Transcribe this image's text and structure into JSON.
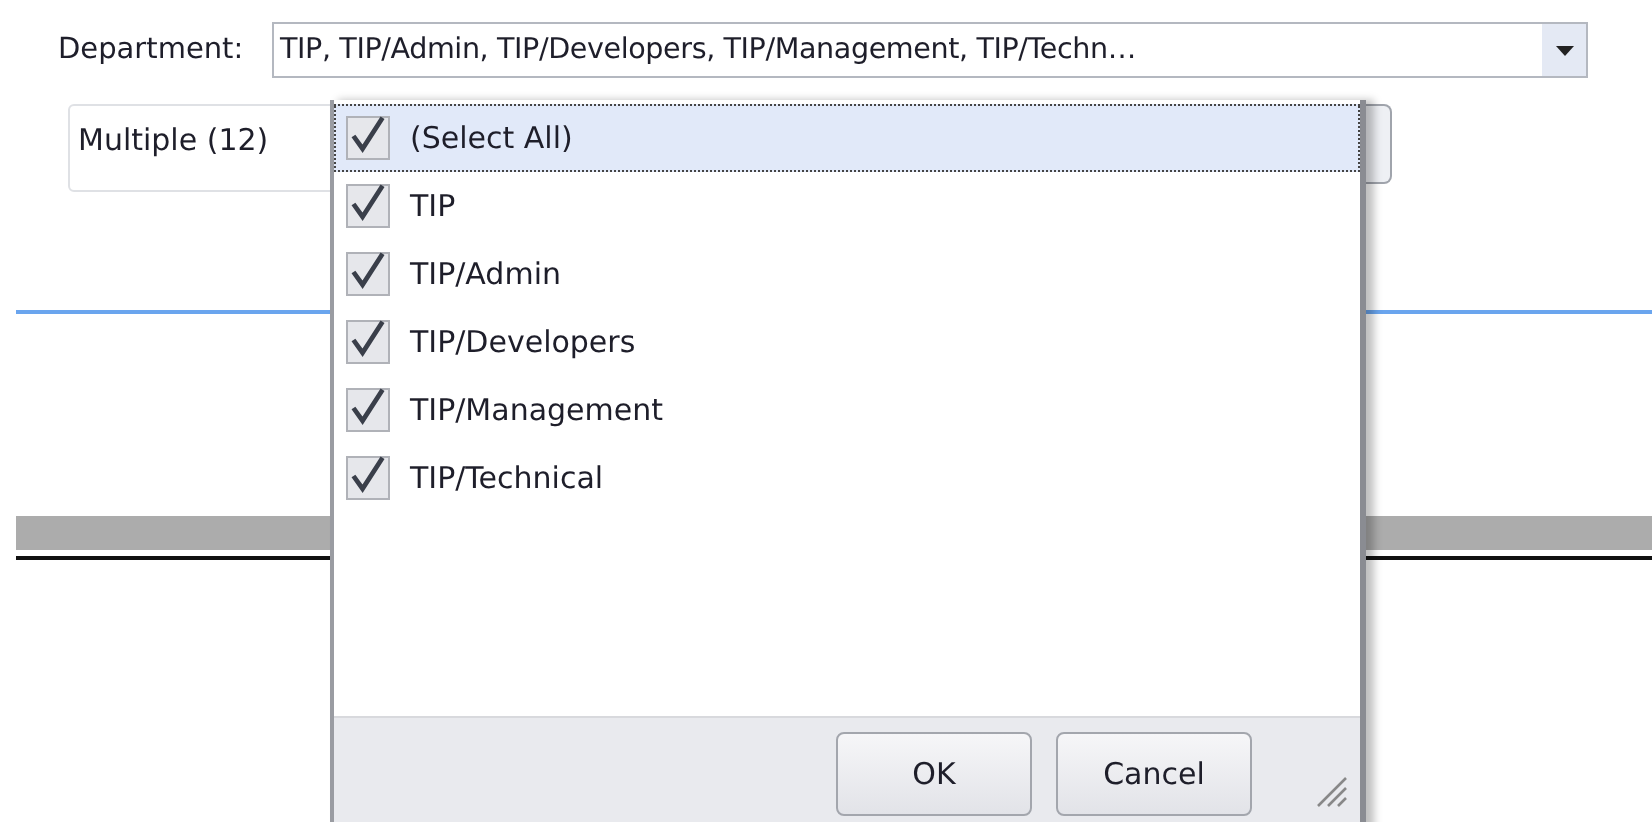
{
  "filter": {
    "label": "Department:",
    "value": "TIP, TIP/Admin, TIP/Developers, TIP/Management, TIP/Techn…"
  },
  "summary_field": {
    "value": "Multiple (12)"
  },
  "popup": {
    "items": [
      {
        "label": "(Select All)",
        "checked": true,
        "selected": true
      },
      {
        "label": "TIP",
        "checked": true,
        "selected": false
      },
      {
        "label": "TIP/Admin",
        "checked": true,
        "selected": false
      },
      {
        "label": "TIP/Developers",
        "checked": true,
        "selected": false
      },
      {
        "label": "TIP/Management",
        "checked": true,
        "selected": false
      },
      {
        "label": "TIP/Technical",
        "checked": true,
        "selected": false
      }
    ],
    "buttons": [
      "OK",
      "Cancel"
    ]
  }
}
